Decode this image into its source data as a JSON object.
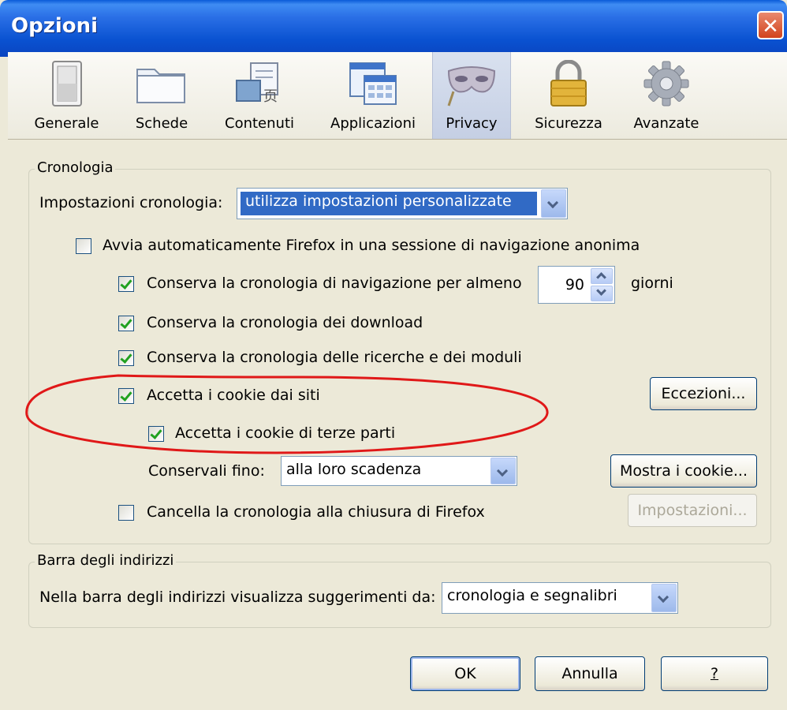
{
  "window": {
    "title": "Opzioni"
  },
  "toolbar": {
    "panes": [
      {
        "label": "Generale",
        "icon": "switch-icon"
      },
      {
        "label": "Schede",
        "icon": "tabs-folder-icon"
      },
      {
        "label": "Contenuti",
        "icon": "content-icon"
      },
      {
        "label": "Applicazioni",
        "icon": "applications-icon"
      },
      {
        "label": "Privacy",
        "icon": "mask-icon",
        "selected": true
      },
      {
        "label": "Sicurezza",
        "icon": "padlock-icon"
      },
      {
        "label": "Avanzate",
        "icon": "gear-icon"
      }
    ]
  },
  "history": {
    "legend": "Cronologia",
    "settings_label": "Impostazioni cronologia:",
    "settings_value": "utilizza impostazioni personalizzate",
    "private_mode": {
      "label": "Avvia automaticamente Firefox in una sessione di navigazione anonima",
      "checked": false
    },
    "keep_history": {
      "label": "Conserva la cronologia di navigazione per almeno",
      "checked": true,
      "days": "90",
      "unit": "giorni"
    },
    "keep_downloads": {
      "label": "Conserva la cronologia dei download",
      "checked": true
    },
    "keep_forms": {
      "label": "Conserva la cronologia delle ricerche e dei moduli",
      "checked": true
    },
    "accept_cookies": {
      "label": "Accetta i cookie dai siti",
      "checked": true
    },
    "third_party": {
      "label": "Accetta i cookie di terze parti",
      "checked": true
    },
    "keep_until_label": "Conservali fino:",
    "keep_until_value": "alla loro scadenza",
    "clear_on_close": {
      "label": "Cancella la cronologia alla chiusura di Firefox",
      "checked": false
    },
    "exceptions_button": "Eccezioni...",
    "show_cookies_button": "Mostra i cookie...",
    "settings_button": "Impostazioni..."
  },
  "location_bar": {
    "legend": "Barra degli indirizzi",
    "label": "Nella barra degli indirizzi visualizza suggerimenti da:",
    "value": "cronologia e segnalibri"
  },
  "buttons": {
    "ok": "OK",
    "cancel": "Annulla",
    "help": "?"
  },
  "colors": {
    "titlebar": "#0a52d1",
    "dialog_bg": "#ece9d8",
    "highlight_ellipse": "#e01818",
    "check": "#21a121"
  }
}
